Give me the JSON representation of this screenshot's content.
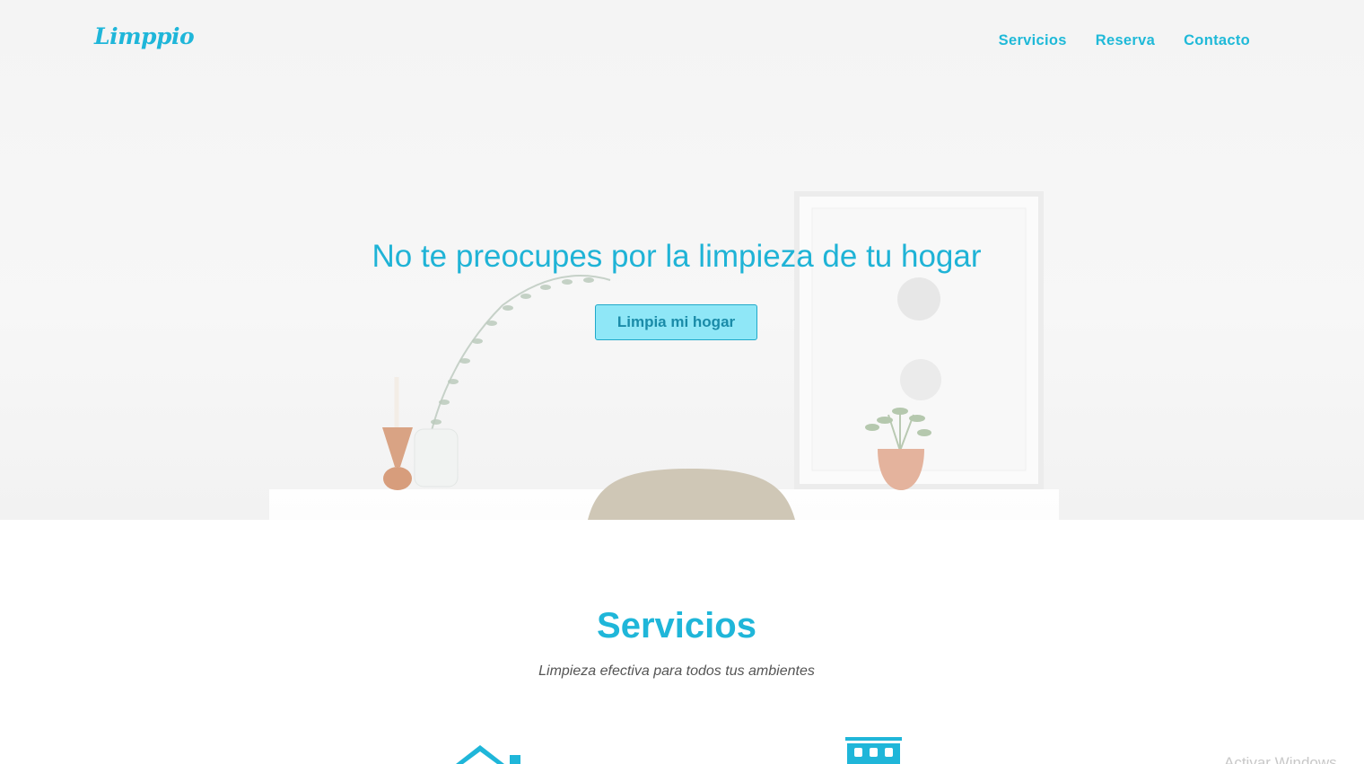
{
  "brand": {
    "name": "Limppio"
  },
  "nav": {
    "items": [
      {
        "label": "Servicios"
      },
      {
        "label": "Reserva"
      },
      {
        "label": "Contacto"
      }
    ]
  },
  "hero": {
    "title": "No te preocupes por la limpieza de tu hogar",
    "cta_label": "Limpia mi hogar"
  },
  "services": {
    "title": "Servicios",
    "subtitle": "Limpieza efectiva para todos tus ambientes",
    "icons": [
      "house-icon",
      "building-icon"
    ]
  },
  "colors": {
    "accent": "#1fb6d9",
    "button_fill": "#8fe7f7",
    "button_text": "#1a8ba8",
    "subtitle_text": "#555555"
  },
  "watermark": {
    "text": "Activar Windows"
  }
}
